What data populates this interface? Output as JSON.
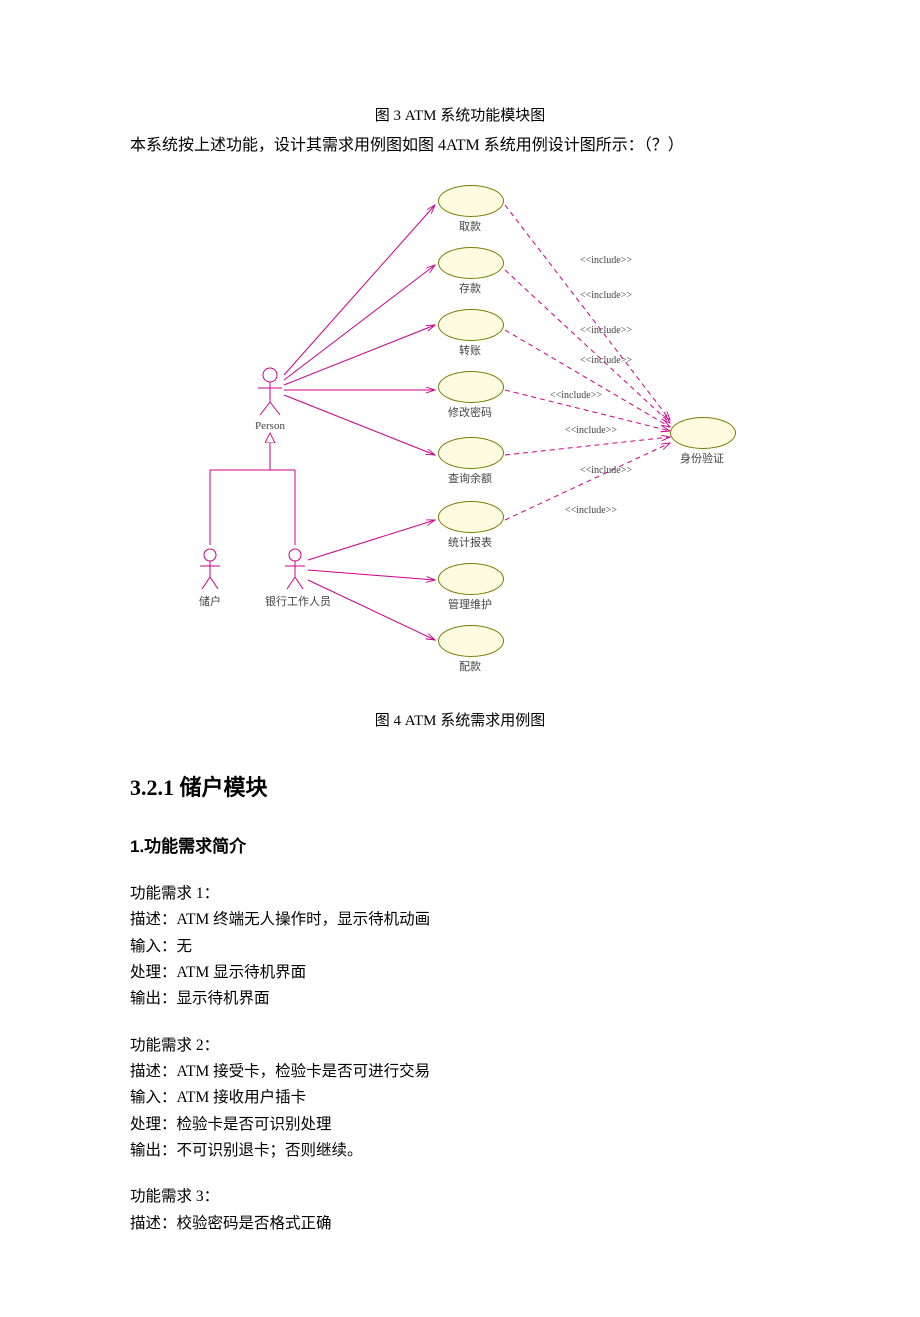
{
  "captions": {
    "fig3": "图 3 ATM 系统功能模块图",
    "intro": "本系统按上述功能，设计其需求用例图如图 4ATM 系统用例设计图所示：（？）",
    "fig4": "图 4 ATM 系统需求用例图"
  },
  "diagram": {
    "actors": {
      "person": "Person",
      "cust": "储户",
      "staff": "银行工作人员"
    },
    "usecases": {
      "uc1": "取款",
      "uc2": "存款",
      "uc3": "转账",
      "uc4": "修改密码",
      "uc5": "查询余额",
      "uc6": "统计报表",
      "uc7": "管理维护",
      "uc8": "配款",
      "uc9": "身份验证"
    },
    "include": "<<include>>"
  },
  "sections": {
    "h1": "3.2.1  储户模块",
    "h2": "1.功能需求简介"
  },
  "reqs": {
    "r1": {
      "t": "功能需求 1：",
      "d": "描述：ATM 终端无人操作时，显示待机动画",
      "i": "输入：无",
      "p": "处理：ATM 显示待机界面",
      "o": "输出：显示待机界面"
    },
    "r2": {
      "t": "功能需求 2：",
      "d": "描述：ATM 接受卡，检验卡是否可进行交易",
      "i": "输入：ATM 接收用户插卡",
      "p": "处理：检验卡是否可识别处理",
      "o": "输出：不可识别退卡；否则继续。"
    },
    "r3": {
      "t": "功能需求 3：",
      "d": "描述：校验密码是否格式正确"
    }
  }
}
